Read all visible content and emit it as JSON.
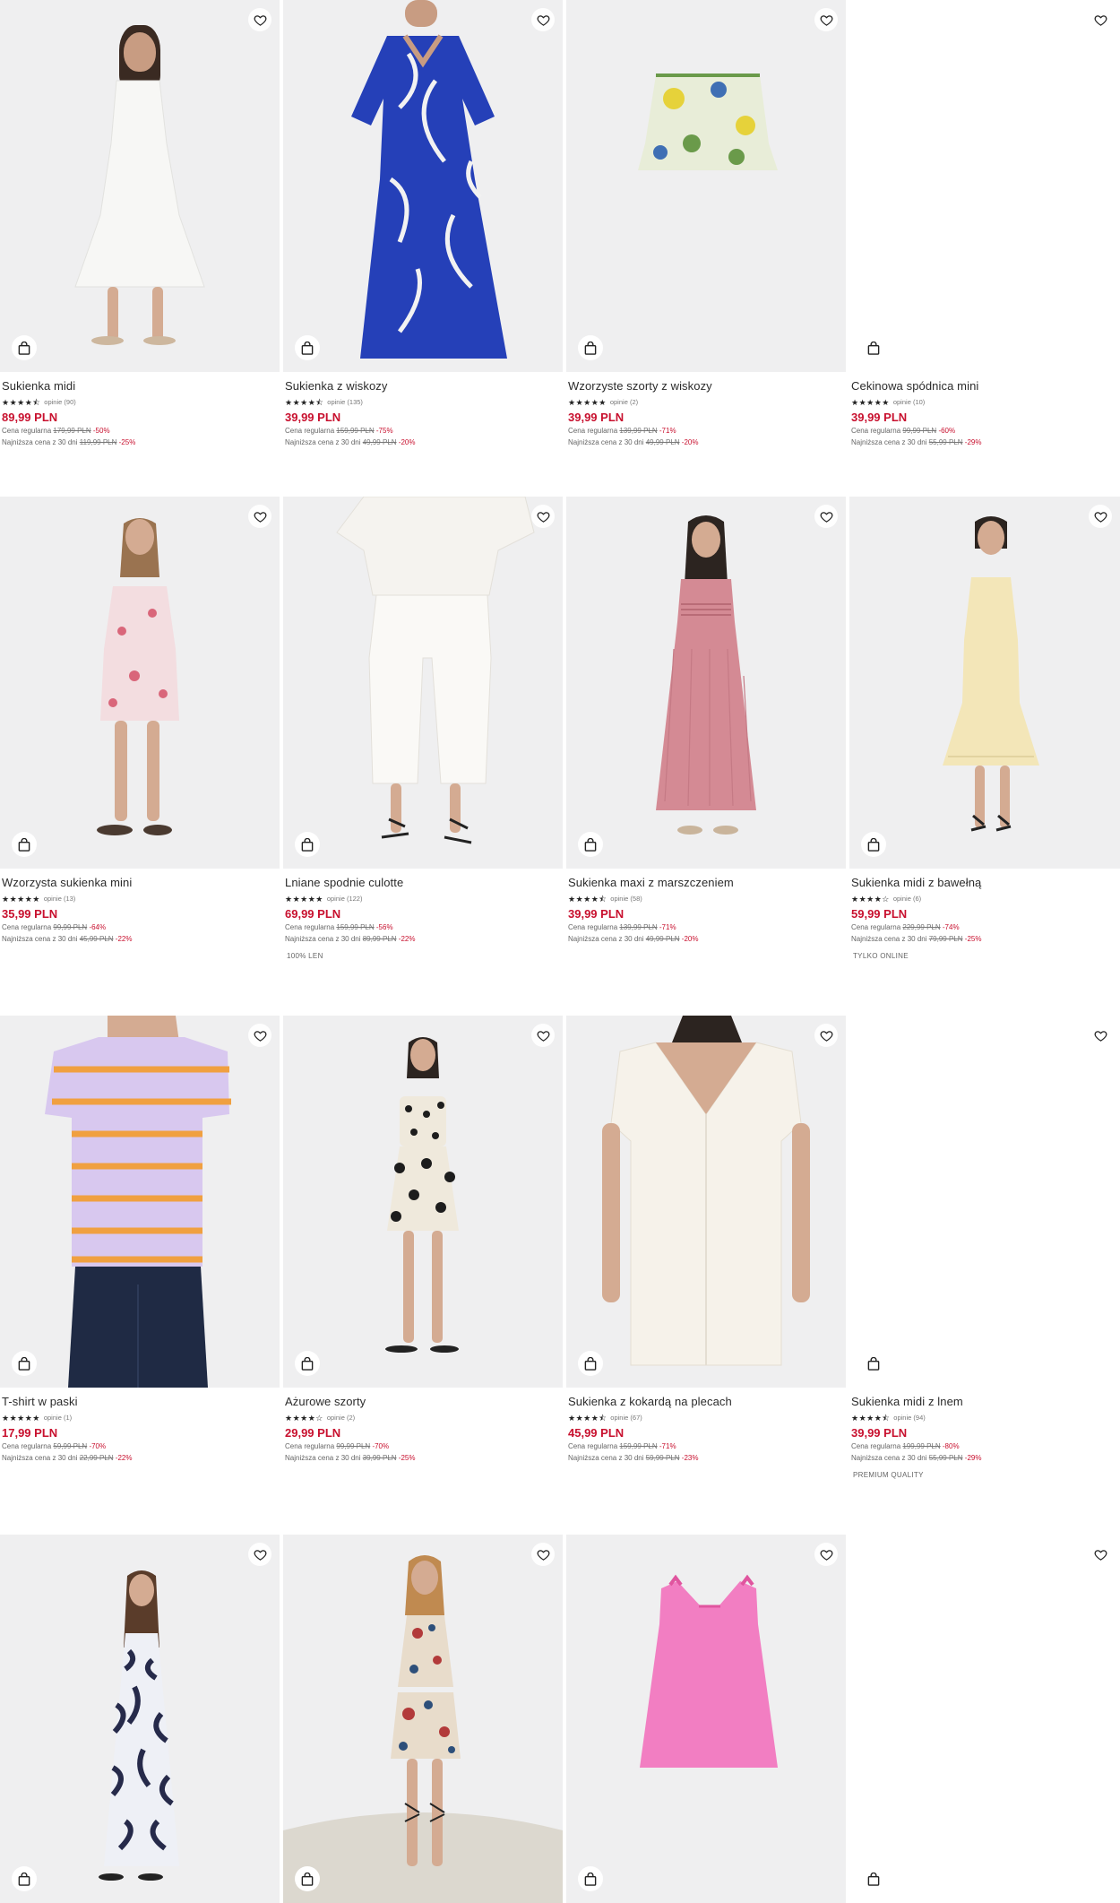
{
  "colors": {
    "price_red": "#c8102e",
    "image_bg": "#efeff0",
    "text": "#2b2b2b"
  },
  "icons": {
    "wishlist": "heart-icon",
    "cart": "shopping-bag-icon",
    "rating": "star-icon"
  },
  "products": [
    {
      "name": "Sukienka midi",
      "stars": "★★★★⯪",
      "reviews": "opinie (90)",
      "price": "89,99 PLN",
      "regular_label": "Cena regularna",
      "regular_price": "179,99 PLN",
      "regular_pct": "-50%",
      "lowest_label": "Najniższa cena z 30 dni",
      "lowest_price": "119,99 PLN",
      "lowest_pct": "-25%",
      "tag": ""
    },
    {
      "name": "Sukienka z wiskozy",
      "stars": "★★★★⯪",
      "reviews": "opinie (135)",
      "price": "39,99 PLN",
      "regular_label": "Cena regularna",
      "regular_price": "159,99 PLN",
      "regular_pct": "-75%",
      "lowest_label": "Najniższa cena z 30 dni",
      "lowest_price": "49,99 PLN",
      "lowest_pct": "-20%",
      "tag": ""
    },
    {
      "name": "Wzorzyste szorty z wiskozy",
      "stars": "★★★★★",
      "reviews": "opinie (2)",
      "price": "39,99 PLN",
      "regular_label": "Cena regularna",
      "regular_price": "139,99 PLN",
      "regular_pct": "-71%",
      "lowest_label": "Najniższa cena z 30 dni",
      "lowest_price": "49,99 PLN",
      "lowest_pct": "-20%",
      "tag": ""
    },
    {
      "name": "Cekinowa spódnica mini",
      "stars": "★★★★★",
      "reviews": "opinie (10)",
      "price": "39,99 PLN",
      "regular_label": "Cena regularna",
      "regular_price": "99,99 PLN",
      "regular_pct": "-60%",
      "lowest_label": "Najniższa cena z 30 dni",
      "lowest_price": "55,99 PLN",
      "lowest_pct": "-29%",
      "tag": ""
    },
    {
      "name": "Wzorzysta sukienka mini",
      "stars": "★★★★★",
      "reviews": "opinie (13)",
      "price": "35,99 PLN",
      "regular_label": "Cena regularna",
      "regular_price": "99,99 PLN",
      "regular_pct": "-64%",
      "lowest_label": "Najniższa cena z 30 dni",
      "lowest_price": "45,99 PLN",
      "lowest_pct": "-22%",
      "tag": ""
    },
    {
      "name": "Lniane spodnie culotte",
      "stars": "★★★★★",
      "reviews": "opinie (122)",
      "price": "69,99 PLN",
      "regular_label": "Cena regularna",
      "regular_price": "159,99 PLN",
      "regular_pct": "-56%",
      "lowest_label": "Najniższa cena z 30 dni",
      "lowest_price": "89,99 PLN",
      "lowest_pct": "-22%",
      "tag": "100% LEN"
    },
    {
      "name": "Sukienka maxi z marszczeniem",
      "stars": "★★★★⯪",
      "reviews": "opinie (58)",
      "price": "39,99 PLN",
      "regular_label": "Cena regularna",
      "regular_price": "139,99 PLN",
      "regular_pct": "-71%",
      "lowest_label": "Najniższa cena z 30 dni",
      "lowest_price": "49,99 PLN",
      "lowest_pct": "-20%",
      "tag": ""
    },
    {
      "name": "Sukienka midi z bawełną",
      "stars": "★★★★☆",
      "reviews": "opinie (6)",
      "price": "59,99 PLN",
      "regular_label": "Cena regularna",
      "regular_price": "229,99 PLN",
      "regular_pct": "-74%",
      "lowest_label": "Najniższa cena z 30 dni",
      "lowest_price": "79,99 PLN",
      "lowest_pct": "-25%",
      "tag": "TYLKO ONLINE"
    },
    {
      "name": "T-shirt w paski",
      "stars": "★★★★★",
      "reviews": "opinie (1)",
      "price": "17,99 PLN",
      "regular_label": "Cena regularna",
      "regular_price": "59,99 PLN",
      "regular_pct": "-70%",
      "lowest_label": "Najniższa cena z 30 dni",
      "lowest_price": "22,99 PLN",
      "lowest_pct": "-22%",
      "tag": ""
    },
    {
      "name": "Ażurowe szorty",
      "stars": "★★★★☆",
      "reviews": "opinie (2)",
      "price": "29,99 PLN",
      "regular_label": "Cena regularna",
      "regular_price": "99,99 PLN",
      "regular_pct": "-70%",
      "lowest_label": "Najniższa cena z 30 dni",
      "lowest_price": "39,99 PLN",
      "lowest_pct": "-25%",
      "tag": ""
    },
    {
      "name": "Sukienka z kokardą na plecach",
      "stars": "★★★★⯪",
      "reviews": "opinie (67)",
      "price": "45,99 PLN",
      "regular_label": "Cena regularna",
      "regular_price": "159,99 PLN",
      "regular_pct": "-71%",
      "lowest_label": "Najniższa cena z 30 dni",
      "lowest_price": "59,99 PLN",
      "lowest_pct": "-23%",
      "tag": ""
    },
    {
      "name": "Sukienka midi z lnem",
      "stars": "★★★★⯪",
      "reviews": "opinie (94)",
      "price": "39,99 PLN",
      "regular_label": "Cena regularna",
      "regular_price": "199,99 PLN",
      "regular_pct": "-80%",
      "lowest_label": "Najniższa cena z 30 dni",
      "lowest_price": "55,99 PLN",
      "lowest_pct": "-29%",
      "tag": "PREMIUM QUALITY"
    }
  ]
}
